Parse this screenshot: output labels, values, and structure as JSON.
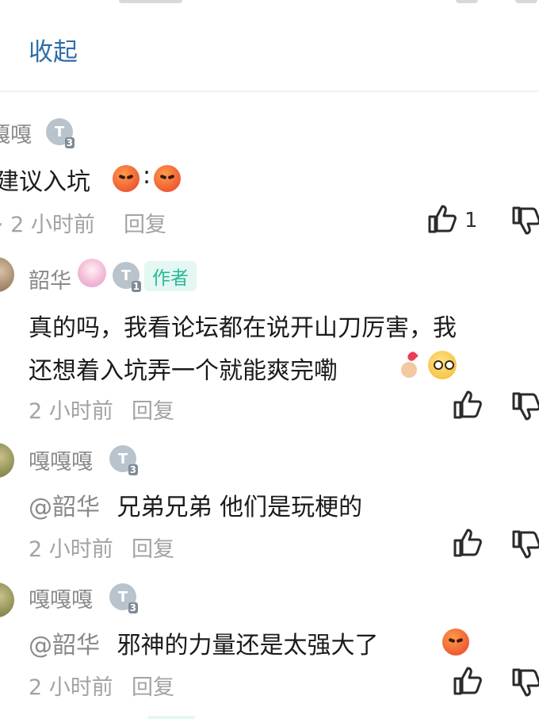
{
  "collapse_label": "收起",
  "colors": {
    "accent": "#2f6ea8",
    "author_tag": "#28b896",
    "muted": "#a3a3a3"
  },
  "top_comment": {
    "username": "嘎嘎",
    "level": "3",
    "text": "建议入坑",
    "text_sep": ":",
    "meta": "· 2 小时前",
    "reply": "回复",
    "likes": "1"
  },
  "replies": [
    {
      "username": "韶华",
      "level": "1",
      "author_tag": "作者",
      "text_line1": "真的吗，我看论坛都在说开山刀厉害，我",
      "text_line2": "还想着入坑弄一个就能爽完嘞",
      "time": "2 小时前",
      "reply": "回复"
    },
    {
      "username": "嘎嘎嘎",
      "level": "3",
      "mention": "@韶华",
      "text": "兄弟兄弟 他们是玩梗的",
      "time": "2 小时前",
      "reply": "回复"
    },
    {
      "username": "嘎嘎嘎",
      "level": "3",
      "mention": "@韶华",
      "text": "邪神的力量还是太强大了",
      "time": "2 小时前",
      "reply": "回复"
    }
  ],
  "icons": [
    "thumbs-up-icon",
    "thumbs-down-icon",
    "level-badge-icon",
    "angry-face-emoji",
    "finger-heart-emoji",
    "shocked-face-emoji"
  ]
}
